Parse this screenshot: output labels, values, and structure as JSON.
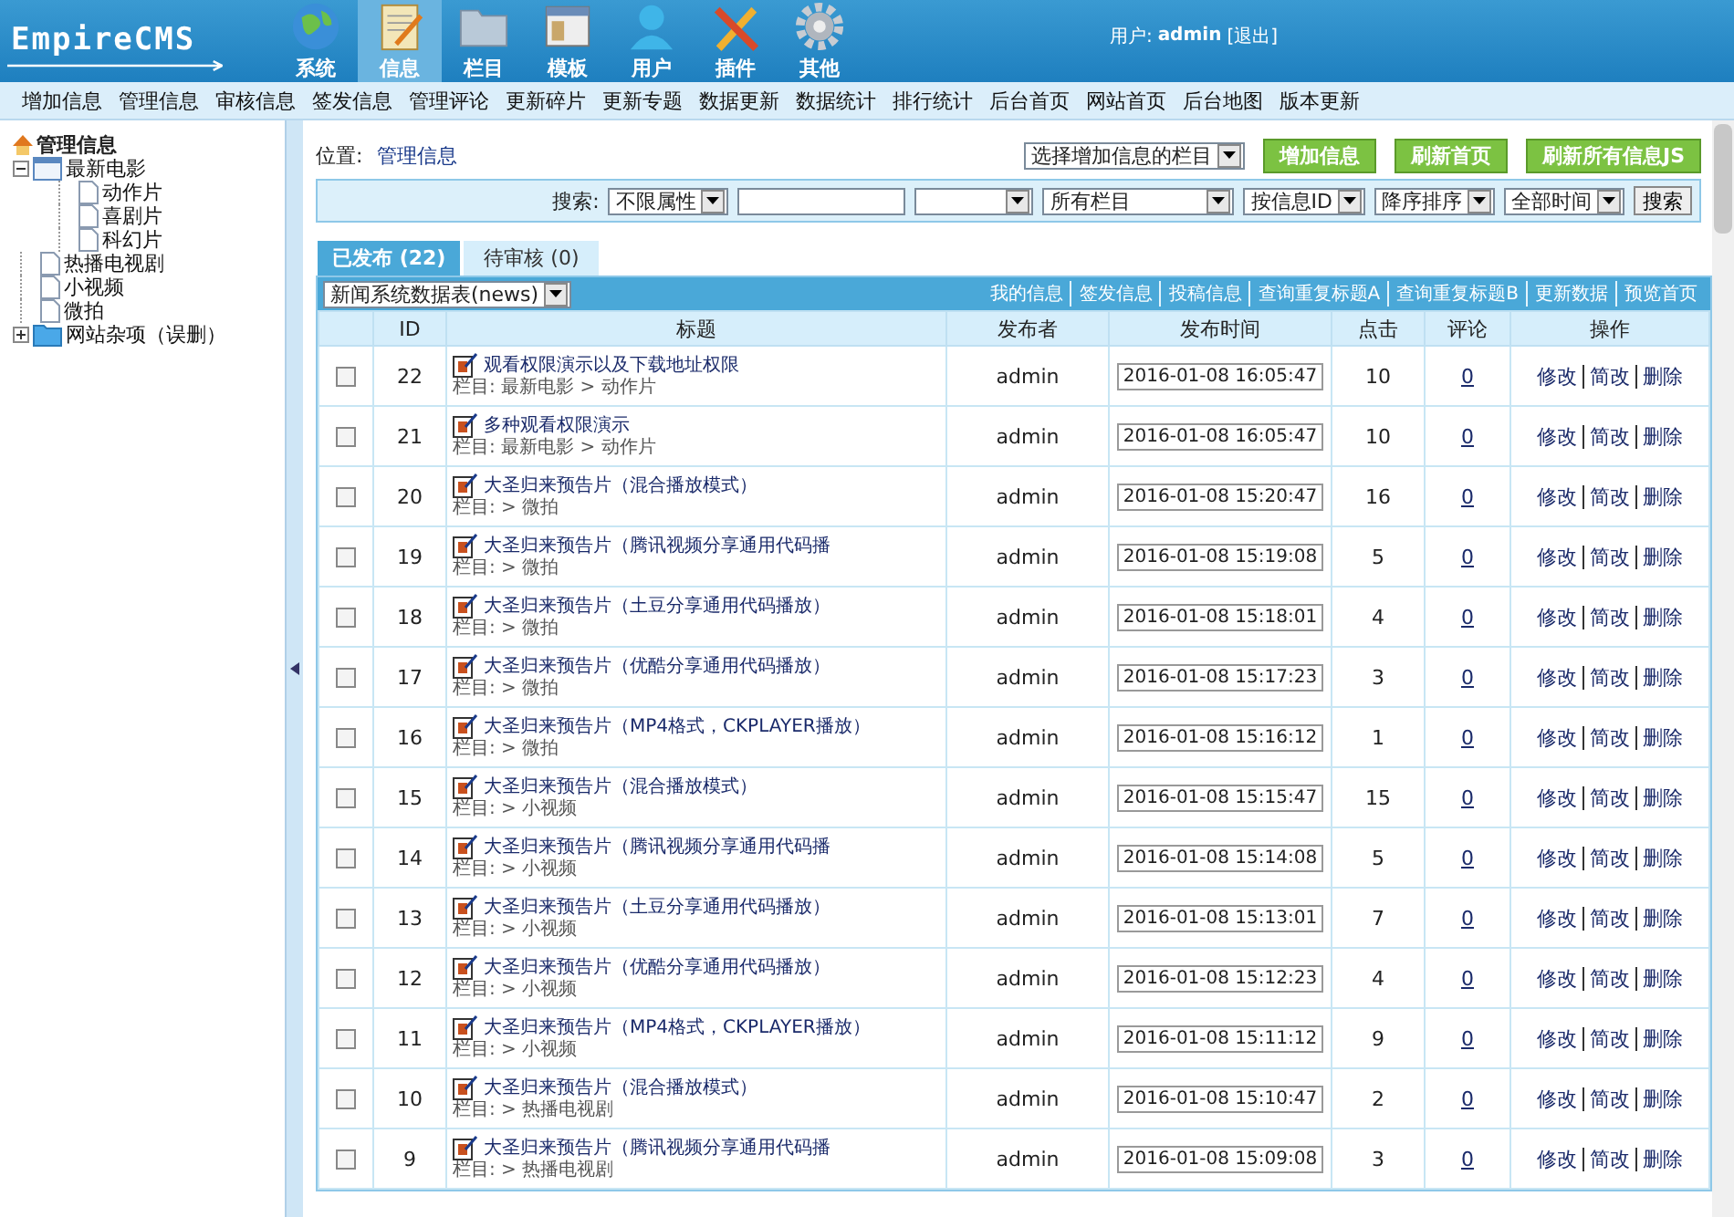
{
  "header": {
    "logo": "EmpireCMS",
    "nav": [
      {
        "label": "系统",
        "selected": false
      },
      {
        "label": "信息",
        "selected": true
      },
      {
        "label": "栏目",
        "selected": false
      },
      {
        "label": "模板",
        "selected": false
      },
      {
        "label": "用户",
        "selected": false
      },
      {
        "label": "插件",
        "selected": false
      },
      {
        "label": "其他",
        "selected": false
      }
    ],
    "user_label": "用户:",
    "user_name": "admin",
    "logout": "[退出]"
  },
  "menu_bar": [
    "增加信息",
    "管理信息",
    "审核信息",
    "签发信息",
    "管理评论",
    "更新碎片",
    "更新专题",
    "数据更新",
    "数据统计",
    "排行统计",
    "后台首页",
    "网站首页",
    "后台地图",
    "版本更新"
  ],
  "sidebar": {
    "title": "管理信息",
    "items": [
      {
        "label": "最新电影",
        "expanded": true,
        "children": [
          {
            "label": "动作片"
          },
          {
            "label": "喜剧片"
          },
          {
            "label": "科幻片"
          }
        ]
      },
      {
        "label": "热播电视剧"
      },
      {
        "label": "小视频"
      },
      {
        "label": "微拍"
      },
      {
        "label": "网站杂项（误删）",
        "expanded": false
      }
    ]
  },
  "location": {
    "label": "位置:",
    "link": "管理信息"
  },
  "column_select": "选择增加信息的栏目",
  "actions": [
    "增加信息",
    "刷新首页",
    "刷新所有信息JS"
  ],
  "search": {
    "label": "搜索:",
    "fields": [
      {
        "kind": "select",
        "value": "不限属性"
      },
      {
        "kind": "input"
      },
      {
        "kind": "select"
      },
      {
        "kind": "wide",
        "value": "所有栏目"
      },
      {
        "kind": "select",
        "value": "按信息ID"
      },
      {
        "kind": "select",
        "value": "降序排序"
      },
      {
        "kind": "select",
        "value": "全部时间"
      }
    ],
    "button": "搜索"
  },
  "tabs": [
    {
      "label": "已发布 (22)",
      "selected": true
    },
    {
      "label": "待审核 (0)",
      "selected": false
    }
  ],
  "table_select": "新闻系统数据表(news)",
  "table_links": [
    "我的信息",
    "签发信息",
    "投稿信息",
    "查询重复标题A",
    "查询重复标题B",
    "更新数据",
    "预览首页"
  ],
  "table": {
    "columns": [
      "ID",
      "标题",
      "发布者",
      "发布时间",
      "点击",
      "评论",
      "操作"
    ],
    "rows": [
      {
        "checked": false,
        "id": "22",
        "title": "观看权限演示以及下载地址权限",
        "category": "栏目: 最新电影 > 动作片",
        "publisher": "admin",
        "time": "2016-01-08 16:05:47",
        "clicks": "10",
        "comments": "0",
        "actions": [
          "修改",
          "简改",
          "删除"
        ]
      },
      {
        "checked": false,
        "id": "21",
        "title": "多种观看权限演示",
        "category": "栏目: 最新电影 > 动作片",
        "publisher": "admin",
        "time": "2016-01-08 16:05:47",
        "clicks": "10",
        "comments": "0",
        "actions": [
          "修改",
          "简改",
          "删除"
        ]
      },
      {
        "checked": false,
        "id": "20",
        "title": "大圣归来预告片（混合播放模式）",
        "category": "栏目: > 微拍",
        "publisher": "admin",
        "time": "2016-01-08 15:20:47",
        "clicks": "16",
        "comments": "0",
        "actions": [
          "修改",
          "简改",
          "删除"
        ]
      },
      {
        "checked": false,
        "id": "19",
        "title": "大圣归来预告片（腾讯视频分享通用代码播",
        "category": "栏目: > 微拍",
        "publisher": "admin",
        "time": "2016-01-08 15:19:08",
        "clicks": "5",
        "comments": "0",
        "actions": [
          "修改",
          "简改",
          "删除"
        ]
      },
      {
        "checked": false,
        "id": "18",
        "title": "大圣归来预告片（土豆分享通用代码播放）",
        "category": "栏目: > 微拍",
        "publisher": "admin",
        "time": "2016-01-08 15:18:01",
        "clicks": "4",
        "comments": "0",
        "actions": [
          "修改",
          "简改",
          "删除"
        ]
      },
      {
        "checked": false,
        "id": "17",
        "title": "大圣归来预告片（优酷分享通用代码播放）",
        "category": "栏目: > 微拍",
        "publisher": "admin",
        "time": "2016-01-08 15:17:23",
        "clicks": "3",
        "comments": "0",
        "actions": [
          "修改",
          "简改",
          "删除"
        ]
      },
      {
        "checked": false,
        "id": "16",
        "title": "大圣归来预告片（MP4格式，CKPLAYER播放）",
        "category": "栏目: > 微拍",
        "publisher": "admin",
        "time": "2016-01-08 15:16:12",
        "clicks": "1",
        "comments": "0",
        "actions": [
          "修改",
          "简改",
          "删除"
        ]
      },
      {
        "checked": false,
        "id": "15",
        "title": "大圣归来预告片（混合播放模式）",
        "category": "栏目: > 小视频",
        "publisher": "admin",
        "time": "2016-01-08 15:15:47",
        "clicks": "15",
        "comments": "0",
        "actions": [
          "修改",
          "简改",
          "删除"
        ]
      },
      {
        "checked": false,
        "id": "14",
        "title": "大圣归来预告片（腾讯视频分享通用代码播",
        "category": "栏目: > 小视频",
        "publisher": "admin",
        "time": "2016-01-08 15:14:08",
        "clicks": "5",
        "comments": "0",
        "actions": [
          "修改",
          "简改",
          "删除"
        ]
      },
      {
        "checked": false,
        "id": "13",
        "title": "大圣归来预告片（土豆分享通用代码播放）",
        "category": "栏目: > 小视频",
        "publisher": "admin",
        "time": "2016-01-08 15:13:01",
        "clicks": "7",
        "comments": "0",
        "actions": [
          "修改",
          "简改",
          "删除"
        ]
      },
      {
        "checked": false,
        "id": "12",
        "title": "大圣归来预告片（优酷分享通用代码播放）",
        "category": "栏目: > 小视频",
        "publisher": "admin",
        "time": "2016-01-08 15:12:23",
        "clicks": "4",
        "comments": "0",
        "actions": [
          "修改",
          "简改",
          "删除"
        ]
      },
      {
        "checked": false,
        "id": "11",
        "title": "大圣归来预告片（MP4格式，CKPLAYER播放）",
        "category": "栏目: > 小视频",
        "publisher": "admin",
        "time": "2016-01-08 15:11:12",
        "clicks": "9",
        "comments": "0",
        "actions": [
          "修改",
          "简改",
          "删除"
        ]
      },
      {
        "checked": false,
        "id": "10",
        "title": "大圣归来预告片（混合播放模式）",
        "category": "栏目: > 热播电视剧",
        "publisher": "admin",
        "time": "2016-01-08 15:10:47",
        "clicks": "2",
        "comments": "0",
        "actions": [
          "修改",
          "简改",
          "删除"
        ]
      },
      {
        "checked": false,
        "id": "9",
        "title": "大圣归来预告片（腾讯视频分享通用代码播",
        "category": "栏目: > 热播电视剧",
        "publisher": "admin",
        "time": "2016-01-08 15:09:08",
        "clicks": "3",
        "comments": "0",
        "actions": [
          "修改",
          "简改",
          "删除"
        ]
      }
    ]
  }
}
